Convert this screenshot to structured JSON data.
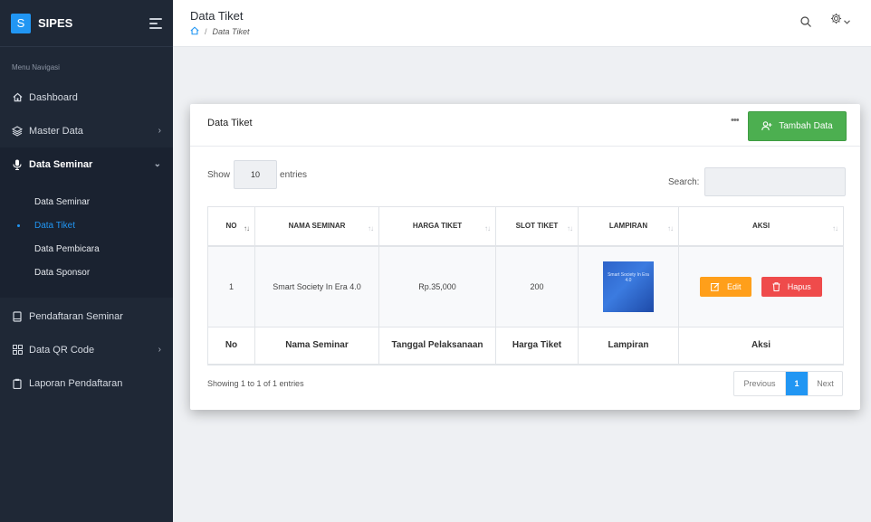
{
  "sidebar": {
    "logo_letter": "S",
    "app_name": "SIPES",
    "menu_caption": "Menu Navigasi",
    "items": [
      {
        "label": "Dashboard",
        "icon": "home-icon"
      },
      {
        "label": "Master Data",
        "icon": "layers-icon"
      },
      {
        "label": "Data Seminar",
        "icon": "microphone-icon"
      },
      {
        "label": "Pendaftaran Seminar",
        "icon": "book-icon"
      },
      {
        "label": "Data QR Code",
        "icon": "qrcode-icon"
      },
      {
        "label": "Laporan Pendaftaran",
        "icon": "clipboard-icon"
      }
    ],
    "submenu": [
      {
        "label": "Data Seminar"
      },
      {
        "label": "Data Tiket"
      },
      {
        "label": "Data Pembicara"
      },
      {
        "label": "Data Sponsor"
      }
    ]
  },
  "header": {
    "title": "Data Tiket",
    "breadcrumb_current": "Data Tiket",
    "breadcrumb_sep": "/"
  },
  "card": {
    "title": "Data Tiket",
    "more": "•••",
    "add_button": "Tambah Data",
    "show_label": "Show",
    "entries_label": "entries",
    "page_length": "10",
    "search_label": "Search:",
    "search_value": "",
    "columns": [
      "NO",
      "NAMA SEMINAR",
      "HARGA TIKET",
      "SLOT TIKET",
      "LAMPIRAN",
      "AKSI"
    ],
    "rows": [
      {
        "no": "1",
        "nama": "Smart Society In Era 4.0",
        "harga": "Rp.35,000",
        "slot": "200",
        "lampiran_text": "Smart Society In Era 4.0"
      }
    ],
    "footer_columns": [
      "No",
      "Nama Seminar",
      "Tanggal Pelaksanaan",
      "Harga Tiket",
      "Lampiran",
      "Aksi"
    ],
    "edit_label": "Edit",
    "delete_label": "Hapus",
    "info": "Showing 1 to 1 of 1 entries",
    "pagination": {
      "previous": "Previous",
      "current": "1",
      "next": "Next"
    }
  },
  "colors": {
    "sidebar_bg": "#1f2836",
    "accent": "#2196f3",
    "success": "#4caf50",
    "warning": "#ff9f1a",
    "danger": "#ef4b4b"
  }
}
